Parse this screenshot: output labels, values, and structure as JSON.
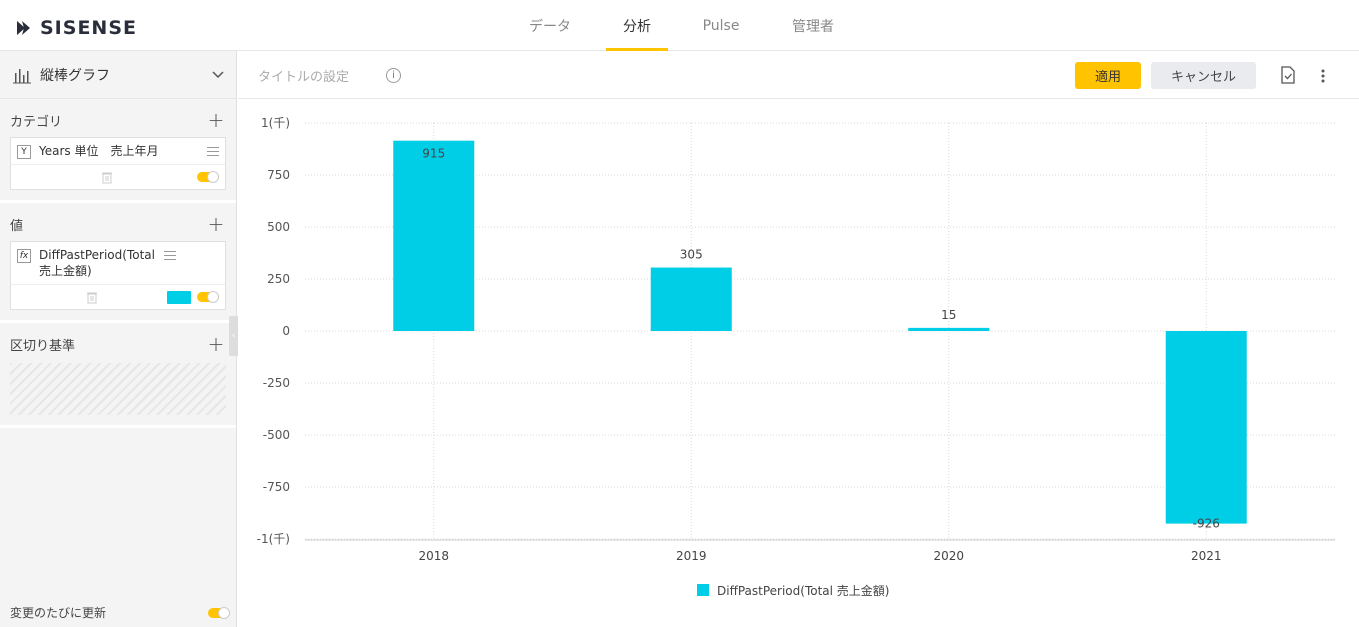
{
  "app": {
    "logo_text": "SISENSE"
  },
  "nav": {
    "items": [
      {
        "label": "データ",
        "active": false
      },
      {
        "label": "分析",
        "active": true
      },
      {
        "label": "Pulse",
        "active": false
      },
      {
        "label": "管理者",
        "active": false
      }
    ]
  },
  "left_panel": {
    "chart_type_label": "縦棒グラフ",
    "category": {
      "title": "カテゴリ",
      "badge": "Y",
      "field": "Years 単位　売上年月"
    },
    "values": {
      "title": "値",
      "badge": "fx",
      "field": "DiffPastPeriod(Total 売上金額)",
      "color": "#00cee6"
    },
    "breakby": {
      "title": "区切り基準"
    },
    "auto_update_label": "変更のたびに更新"
  },
  "toolbar": {
    "title_placeholder": "タイトルの設定",
    "apply_label": "適用",
    "cancel_label": "キャンセル"
  },
  "chart_data": {
    "type": "bar",
    "categories": [
      "2018",
      "2019",
      "2020",
      "2021"
    ],
    "series": [
      {
        "name": "DiffPastPeriod(Total 売上金額)",
        "values": [
          915,
          305,
          15,
          -926
        ],
        "color": "#00cee6"
      }
    ],
    "data_labels": [
      "915",
      "305",
      "15",
      "-926"
    ],
    "yticks": [
      {
        "value": 1000,
        "label": "1(千)"
      },
      {
        "value": 750,
        "label": "750"
      },
      {
        "value": 500,
        "label": "500"
      },
      {
        "value": 250,
        "label": "250"
      },
      {
        "value": 0,
        "label": "0"
      },
      {
        "value": -250,
        "label": "-250"
      },
      {
        "value": -500,
        "label": "-500"
      },
      {
        "value": -750,
        "label": "-750"
      },
      {
        "value": -1000,
        "label": "-1(千)"
      }
    ],
    "ylim": [
      -1000,
      1000
    ],
    "grid": true,
    "legend_position": "bottom"
  }
}
